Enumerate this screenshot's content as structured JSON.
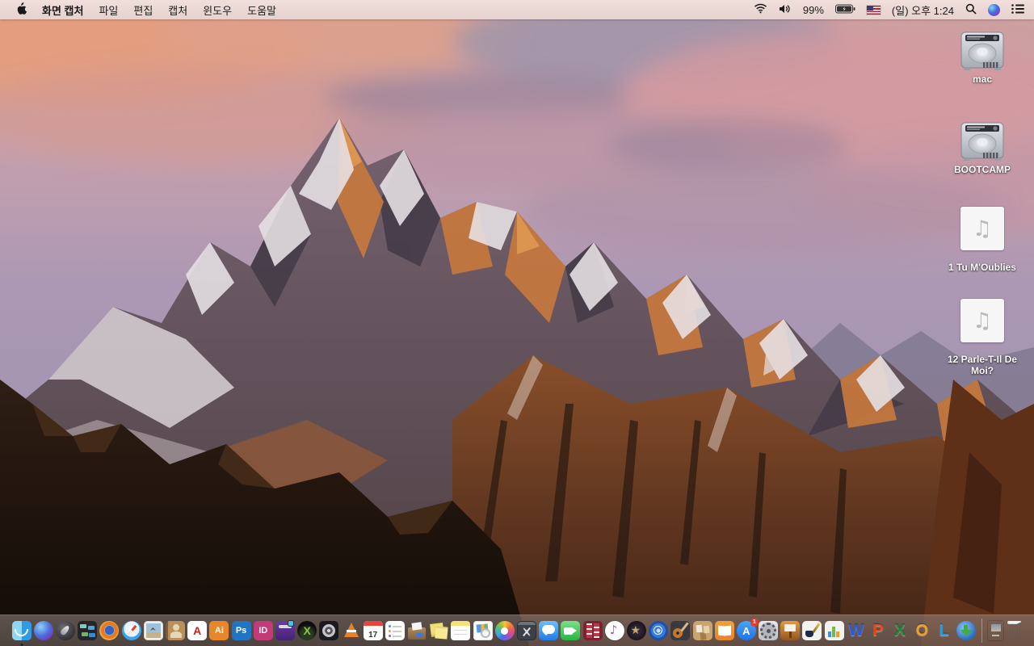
{
  "menu_bar": {
    "app_name": "화면 캡처",
    "menus": [
      "파일",
      "편집",
      "캡처",
      "윈도우",
      "도움말"
    ],
    "status": {
      "battery_percent": "99%",
      "clock": "(일) 오후 1:24"
    }
  },
  "desktop_icons": [
    {
      "label": "mac",
      "type": "hard-drive"
    },
    {
      "label": "BOOTCAMP",
      "type": "hard-drive"
    },
    {
      "label": "1 Tu M'Oublies",
      "type": "audio-file"
    },
    {
      "label": "12 Parle-T-Il De Moi?",
      "type": "audio-file"
    }
  ],
  "dock": {
    "items": [
      {
        "name": "finder",
        "running": true
      },
      {
        "name": "siri"
      },
      {
        "name": "launchpad"
      },
      {
        "name": "mission-control"
      },
      {
        "name": "firefox"
      },
      {
        "name": "safari"
      },
      {
        "name": "photo-viewer"
      },
      {
        "name": "contacts"
      },
      {
        "name": "acrobat-reader",
        "glyph": "A"
      },
      {
        "name": "illustrator",
        "glyph": "Ai"
      },
      {
        "name": "photoshop",
        "glyph": "Ps"
      },
      {
        "name": "indesign",
        "glyph": "ID"
      },
      {
        "name": "toast"
      },
      {
        "name": "x-media-app",
        "glyph": "X"
      },
      {
        "name": "disk-utility-app"
      },
      {
        "name": "vlc"
      },
      {
        "name": "calendar",
        "glyph": "17"
      },
      {
        "name": "reminders"
      },
      {
        "name": "mail-drop-app"
      },
      {
        "name": "stickies"
      },
      {
        "name": "notes"
      },
      {
        "name": "preview"
      },
      {
        "name": "photos"
      },
      {
        "name": "grab-screen-capture",
        "running": true
      },
      {
        "name": "messages"
      },
      {
        "name": "facetime"
      },
      {
        "name": "photo-booth"
      },
      {
        "name": "itunes"
      },
      {
        "name": "imovie"
      },
      {
        "name": "dvd-player"
      },
      {
        "name": "garageband"
      },
      {
        "name": "corkboard-app"
      },
      {
        "name": "ibooks"
      },
      {
        "name": "app-store",
        "glyph": "A",
        "badge": "1"
      },
      {
        "name": "system-preferences"
      },
      {
        "name": "keynote"
      },
      {
        "name": "pages"
      },
      {
        "name": "numbers"
      },
      {
        "name": "word",
        "glyph": "W"
      },
      {
        "name": "powerpoint",
        "glyph": "P"
      },
      {
        "name": "excel",
        "glyph": "X"
      },
      {
        "name": "outlook",
        "glyph": "O"
      },
      {
        "name": "lync",
        "glyph": "L"
      },
      {
        "name": "globe-download-app"
      },
      {
        "name": "document-file"
      },
      {
        "name": "trash"
      }
    ]
  },
  "colors": {
    "menu_bar_bg": "#ecdad6",
    "dock_bg": "#8d7d78",
    "sky_top": "#cf9f9e",
    "mountain_sunlit": "#c9793d"
  }
}
